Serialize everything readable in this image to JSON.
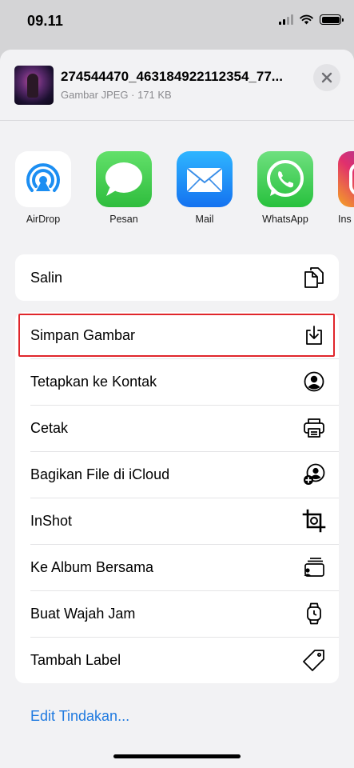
{
  "status_bar": {
    "time": "09.11"
  },
  "header": {
    "file_name": "274544470_463184922112354_77...",
    "file_meta": "Gambar JPEG · 171 KB"
  },
  "apps": [
    {
      "label": "AirDrop",
      "icon": "airdrop-icon"
    },
    {
      "label": "Pesan",
      "icon": "messages-icon"
    },
    {
      "label": "Mail",
      "icon": "mail-icon"
    },
    {
      "label": "WhatsApp",
      "icon": "whatsapp-icon"
    },
    {
      "label": "Ins",
      "icon": "instagram-icon"
    }
  ],
  "actions_top": [
    {
      "label": "Salin",
      "icon": "copy-icon"
    }
  ],
  "actions": [
    {
      "label": "Simpan Gambar",
      "icon": "save-image-icon"
    },
    {
      "label": "Tetapkan ke Kontak",
      "icon": "contact-icon"
    },
    {
      "label": "Cetak",
      "icon": "print-icon"
    },
    {
      "label": "Bagikan File di iCloud",
      "icon": "icloud-share-icon"
    },
    {
      "label": "InShot",
      "icon": "crop-icon"
    },
    {
      "label": "Ke Album Bersama",
      "icon": "shared-album-icon"
    },
    {
      "label": "Buat Wajah Jam",
      "icon": "watch-icon"
    },
    {
      "label": "Tambah Label",
      "icon": "tag-icon"
    }
  ],
  "edit_actions_label": "Edit Tindakan...",
  "colors": {
    "accent": "#1f7ae0",
    "highlight": "#e0262b",
    "sheet": "#f2f2f4"
  }
}
